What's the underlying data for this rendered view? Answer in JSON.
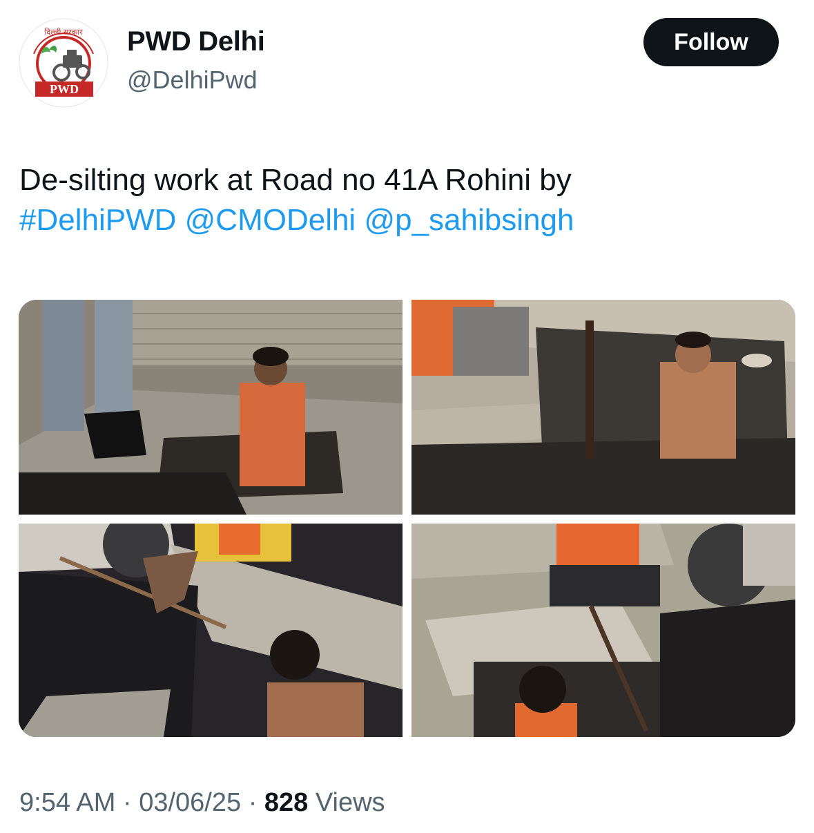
{
  "account": {
    "display_name": "PWD Delhi",
    "handle": "@DelhiPwd",
    "avatar_icon": "pwd-delhi-logo",
    "avatar_logo_text": "PWD",
    "avatar_arc_text": "दिल्ली सरकार"
  },
  "follow_button": {
    "label": "Follow"
  },
  "tweet": {
    "text": "De-silting work at Road no 41A Rohini by",
    "links": [
      "#DelhiPWD",
      "@CMODelhi",
      "@p_sahibsingh"
    ]
  },
  "media": [
    {
      "description": "Worker in orange safety vest standing in drain pit while another shovels black silt"
    },
    {
      "description": "Shirtless worker in drain pit holding a rod, another worker squatting on slab"
    },
    {
      "description": "Worker squatting on slab with rod, another worker below in drain"
    },
    {
      "description": "Worker in orange vest sitting on slab with rod, boy below in drain opening"
    }
  ],
  "meta": {
    "time": "9:54 AM",
    "separator": "·",
    "date": "03/06/25",
    "views_count": "828",
    "views_label": "Views"
  },
  "colors": {
    "text": "#0f1419",
    "secondary_text": "#536471",
    "link": "#1d9bf0",
    "button_bg": "#0f1419"
  }
}
